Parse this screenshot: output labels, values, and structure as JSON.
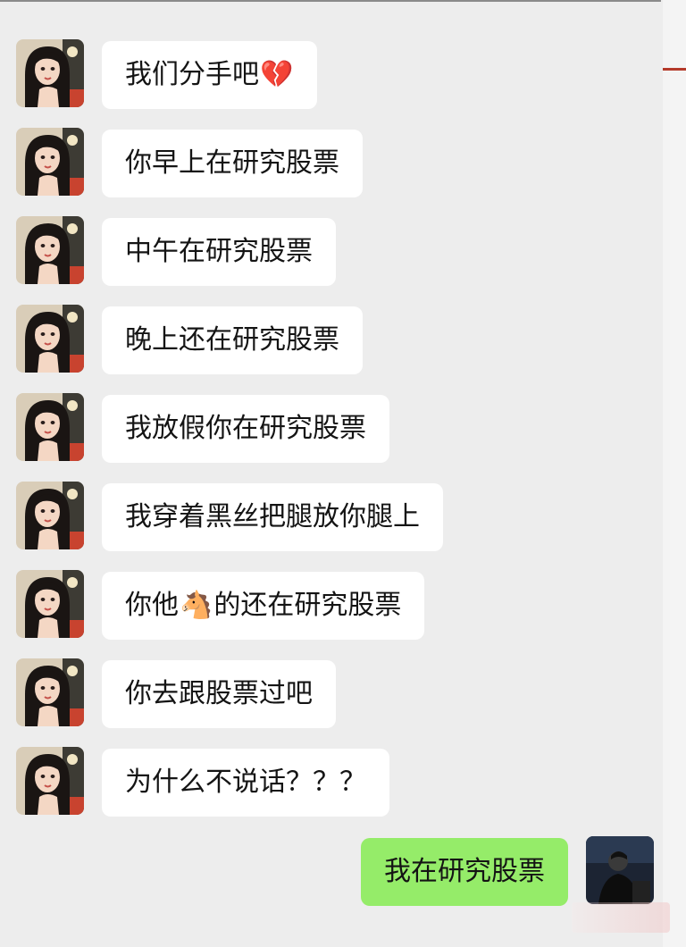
{
  "chat": {
    "incoming_messages": [
      {
        "text": "我们分手吧",
        "emoji": "💔"
      },
      {
        "text": "你早上在研究股票"
      },
      {
        "text": "中午在研究股票"
      },
      {
        "text": "晚上还在研究股票"
      },
      {
        "text": "我放假你在研究股票"
      },
      {
        "text": "我穿着黑丝把腿放你腿上"
      },
      {
        "text_before": "你他",
        "emoji": "🐴",
        "text_after": "的还在研究股票"
      },
      {
        "text": "你去跟股票过吧"
      },
      {
        "text": "为什么不说话？？？"
      }
    ],
    "outgoing_messages": [
      {
        "text": "我在研究股票"
      }
    ]
  },
  "colors": {
    "background": "#ededed",
    "incoming_bubble": "#ffffff",
    "outgoing_bubble": "#95ec69"
  },
  "icons": {
    "incoming_avatar": "woman-portrait-avatar",
    "outgoing_avatar": "man-portrait-avatar"
  }
}
